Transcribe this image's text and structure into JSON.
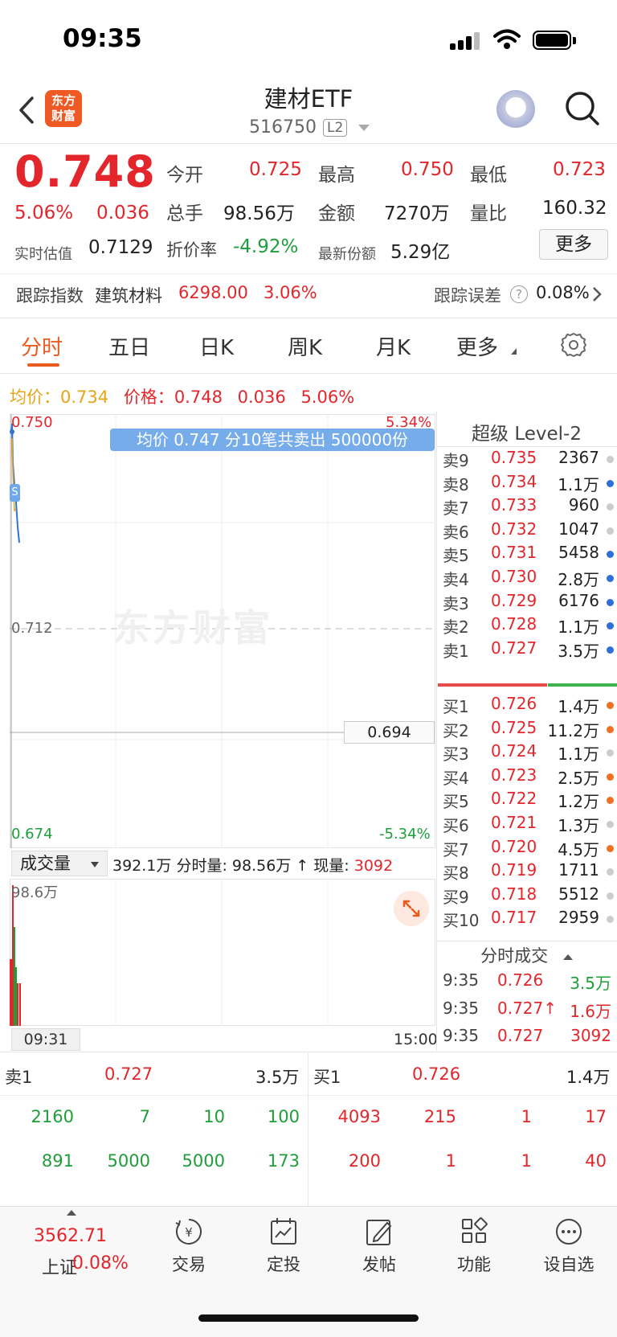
{
  "status": {
    "time": "09:35"
  },
  "header": {
    "logo_line1": "东方",
    "logo_line2": "财富",
    "title": "建材ETF",
    "code": "516750",
    "level": "L2"
  },
  "quote": {
    "price": "0.748",
    "change_pct": "5.06%",
    "change": "0.036",
    "est_label": "实时估值",
    "est_value": "0.7129",
    "open_label": "今开",
    "open": "0.725",
    "high_label": "最高",
    "high": "0.750",
    "low_label": "最低",
    "low": "0.723",
    "vol_label": "总手",
    "vol": "98.56万",
    "amount_label": "金额",
    "amount": "7270万",
    "ratio_label": "量比",
    "ratio": "160.32",
    "discount_label": "折价率",
    "discount": "-4.92%",
    "shares_label": "最新份额",
    "shares": "5.29亿",
    "more": "更多"
  },
  "tracking": {
    "label": "跟踪指数",
    "index_name": "建筑材料",
    "index_value": "6298.00",
    "index_pct": "3.06%",
    "error_label": "跟踪误差",
    "error_value": "0.08%"
  },
  "tabs": [
    "分时",
    "五日",
    "日K",
    "周K",
    "月K",
    "更多"
  ],
  "chart": {
    "avg_label": "均价：",
    "avg": "0.734",
    "price_label": "价格：",
    "price": "0.748",
    "change": "0.036",
    "pct": "5.06%",
    "y_top": "0.750",
    "y_mid": "0.712",
    "y_bot": "0.674",
    "pct_top": "5.34%",
    "pct_bot": "-5.34%",
    "tooltip": "均价 0.747  分10笔共卖出 500000份",
    "watermark": "东方财富",
    "cursor_price": "0.694",
    "marker": "S",
    "vol_select": "成交量",
    "vol_total": "392.1万",
    "vol_info_label": "分时量: 98.56万 ↑ 现量: ",
    "vol_now": "3092",
    "vol_max": "98.6万",
    "time_start": "09:31",
    "time_end": "15:00"
  },
  "level2": {
    "title": "超级 Level-2",
    "asks": [
      {
        "label": "卖9",
        "price": "0.735",
        "vol": "2367",
        "dot": "#cccccc"
      },
      {
        "label": "卖8",
        "price": "0.734",
        "vol": "1.1万",
        "dot": "#2f6fd8"
      },
      {
        "label": "卖7",
        "price": "0.733",
        "vol": "960",
        "dot": "#cccccc"
      },
      {
        "label": "卖6",
        "price": "0.732",
        "vol": "1047",
        "dot": "#cccccc"
      },
      {
        "label": "卖5",
        "price": "0.731",
        "vol": "5458",
        "dot": "#2f6fd8"
      },
      {
        "label": "卖4",
        "price": "0.730",
        "vol": "2.8万",
        "dot": "#2f6fd8"
      },
      {
        "label": "卖3",
        "price": "0.729",
        "vol": "6176",
        "dot": "#2f6fd8"
      },
      {
        "label": "卖2",
        "price": "0.728",
        "vol": "1.1万",
        "dot": "#2f6fd8"
      },
      {
        "label": "卖1",
        "price": "0.727",
        "vol": "3.5万",
        "dot": "#2f6fd8"
      }
    ],
    "bids": [
      {
        "label": "买1",
        "price": "0.726",
        "vol": "1.4万",
        "dot": "#f07020"
      },
      {
        "label": "买2",
        "price": "0.725",
        "vol": "11.2万",
        "dot": "#f07020"
      },
      {
        "label": "买3",
        "price": "0.724",
        "vol": "1.1万",
        "dot": "#cccccc"
      },
      {
        "label": "买4",
        "price": "0.723",
        "vol": "2.5万",
        "dot": "#f07020"
      },
      {
        "label": "买5",
        "price": "0.722",
        "vol": "1.2万",
        "dot": "#f07020"
      },
      {
        "label": "买6",
        "price": "0.721",
        "vol": "1.3万",
        "dot": "#cccccc"
      },
      {
        "label": "买7",
        "price": "0.720",
        "vol": "4.5万",
        "dot": "#f07020"
      },
      {
        "label": "买8",
        "price": "0.719",
        "vol": "1711",
        "dot": "#cccccc"
      },
      {
        "label": "买9",
        "price": "0.718",
        "vol": "5512",
        "dot": "#cccccc"
      },
      {
        "label": "买10",
        "price": "0.717",
        "vol": "2959",
        "dot": "#cccccc"
      }
    ],
    "trades_title": "分时成交",
    "trades": [
      {
        "time": "9:35",
        "price": "0.726",
        "vol": "3.5万",
        "price_color": "#e3262b",
        "vol_color": "#1e9e3a"
      },
      {
        "time": "9:35",
        "price": "0.727↑",
        "vol": "1.6万",
        "price_color": "#e3262b",
        "vol_color": "#e3262b"
      },
      {
        "time": "9:35",
        "price": "0.727",
        "vol": "3092",
        "price_color": "#e3262b",
        "vol_color": "#e3262b"
      }
    ]
  },
  "queue": {
    "ask_label": "卖1",
    "ask_price": "0.727",
    "ask_vol": "3.5万",
    "bid_label": "买1",
    "bid_price": "0.726",
    "bid_vol": "1.4万",
    "ask_rows": [
      [
        "2160",
        "7",
        "10",
        "100"
      ],
      [
        "891",
        "5000",
        "5000",
        "173"
      ]
    ],
    "bid_rows": [
      [
        "4093",
        "215",
        "1",
        "17"
      ],
      [
        "200",
        "1",
        "1",
        "40"
      ]
    ]
  },
  "nav": {
    "index_value": "3562.71",
    "index_name": "上证",
    "index_pct": "0.08%",
    "items": [
      "交易",
      "定投",
      "发帖",
      "功能",
      "设自选"
    ]
  }
}
